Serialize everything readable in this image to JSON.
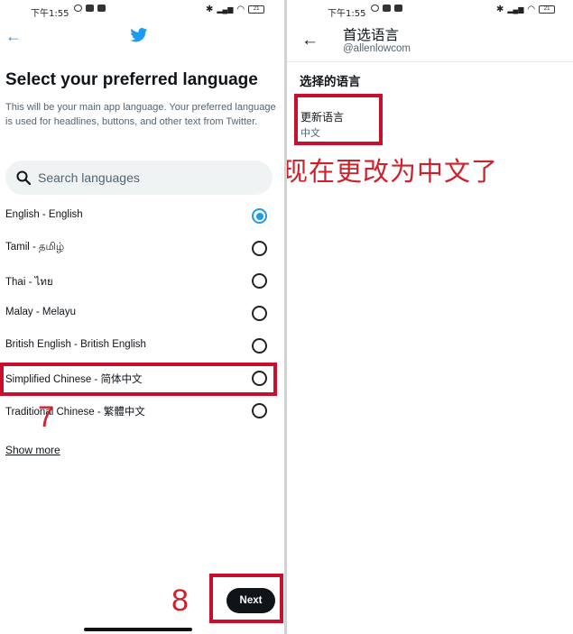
{
  "left": {
    "status": {
      "time": "下午1:55",
      "battery": "21"
    },
    "heading": "Select your preferred language",
    "description": "This will be your main app language. Your preferred language is used for headlines, buttons, and other text from Twitter.",
    "search": {
      "placeholder": "Search languages"
    },
    "languages": [
      {
        "label": "English - English",
        "selected": true
      },
      {
        "label": "Tamil - தமிழ்",
        "selected": false
      },
      {
        "label": "Thai - ไทย",
        "selected": false
      },
      {
        "label": "Malay - Melayu",
        "selected": false
      },
      {
        "label": "British English - British English",
        "selected": false
      },
      {
        "label": "Simplified Chinese - 简体中文",
        "selected": false
      },
      {
        "label": "Traditional Chinese - 繁體中文",
        "selected": false
      }
    ],
    "show_more": "Show more",
    "next_label": "Next",
    "step_7": "7",
    "step_8": "8"
  },
  "right": {
    "status": {
      "time": "下午1:55",
      "battery": "21"
    },
    "title": "首选语言",
    "handle": "@allenlowcom",
    "section": "选择的语言",
    "item_title": "更新语言",
    "item_value": "中文",
    "annotation": "现在更改为中文了"
  },
  "colors": {
    "accent": "#1d9bf0",
    "annotation_red": "#c8102e",
    "button_dark": "#0f1419"
  }
}
